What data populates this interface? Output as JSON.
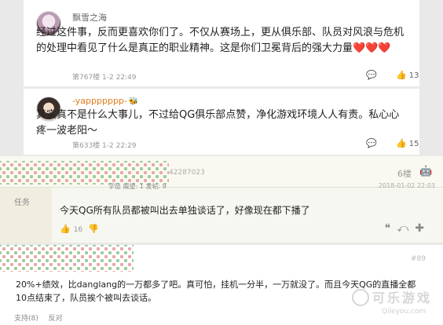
{
  "comments": [
    {
      "username": "飘雪之海",
      "text": "经过这件事，反而更喜欢你们了。不仅从赛场上，更从俱乐部、队员对风浪与危机的处理中看见了什么是真正的职业精神。这是你们卫冕背后的强大力量",
      "hearts": "❤️❤️❤️",
      "meta": "第767楼 1-2 22:49",
      "likes": "13"
    },
    {
      "username": "-yappppppp-",
      "text": "其实真不是什么大事儿，不过给QG俱乐部点赞，净化游戏环境人人有责。私心心疼一波老阳～",
      "meta": "第633楼 1-2 22:29",
      "likes": "15"
    }
  ],
  "post": {
    "id_text": "42287023",
    "stats": "学徒  威望: 1  发帖: 9",
    "floor": "6楼",
    "date": "2018-01-02 22:03",
    "side_tag": "任务",
    "body": "今天QG所有队员都被叫出去单独谈话了，好像现在都下播了",
    "likes": "16"
  },
  "reply": {
    "num": "#89",
    "text": "20%+绩效，比danglang的一万都多了吧。真可怕，挂机一分半，一万就没了。而且今天QG的直播全都10点结束了，队员挨个被叫去谈话。",
    "support": "支持(8)",
    "oppose": "反对"
  },
  "watermark": {
    "cn": "可乐游戏",
    "en": "Qileyou.com"
  }
}
